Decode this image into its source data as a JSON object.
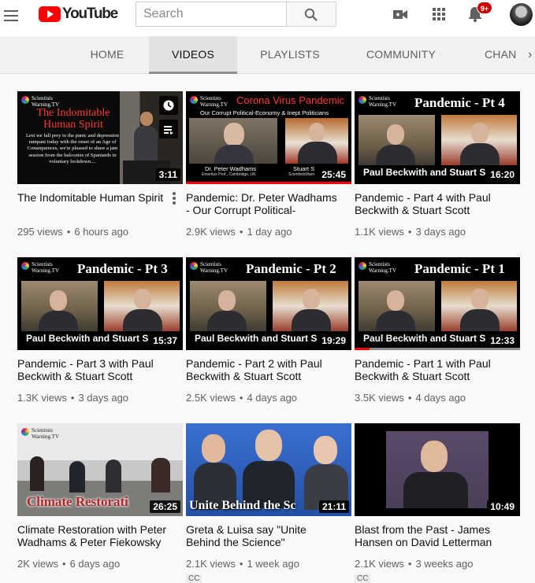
{
  "header": {
    "logo_text": "YouTube",
    "search_placeholder": "Search",
    "notification_count": "9+"
  },
  "tabs": [
    {
      "label": "HOME",
      "active": false
    },
    {
      "label": "VIDEOS",
      "active": true
    },
    {
      "label": "PLAYLISTS",
      "active": false
    },
    {
      "label": "COMMUNITY",
      "active": false
    },
    {
      "label": "CHAN",
      "active": false
    }
  ],
  "videos": [
    {
      "title": "The Indomitable Human Spirit",
      "views": "295 views",
      "age": "6 hours ago",
      "duration": "3:11",
      "thumb_title": "The Indomitable Human Spirit",
      "thumb_text": "Lest we fall prey to the panic and depression rampant today with the onset of an Age of Consequences, we're pleased to share a jam session from the balconies of Spaniards in voluntary lockdown...."
    },
    {
      "title": "Pandemic: Dr. Peter Wadhams - Our Corrupt Political-Economy & Inept Politicians",
      "views": "2.9K views",
      "age": "1 day ago",
      "duration": "25:45",
      "thumb_title": "Corona Virus Pandemic",
      "thumb_subtitle": "Our Corrupt Political-Economy & Inept Politicians",
      "thumb_left_name": "Dr. Peter Wadhams",
      "thumb_left_role": "Emeritus Prof., Cambridge, UK",
      "thumb_right_name": "Stuart S",
      "thumb_right_role": "ScientistsWarn",
      "progress": 1.0
    },
    {
      "title": "Pandemic - Part 4 with Paul Beckwith & Stuart Scott",
      "views": "1.1K views",
      "age": "3 days ago",
      "duration": "16:20",
      "thumb_title": "Pandemic - Pt 4",
      "thumb_caption": "Paul Beckwith and Stuart S"
    },
    {
      "title": "Pandemic - Part 3 with Paul Beckwith & Stuart Scott",
      "views": "1.3K views",
      "age": "3 days ago",
      "duration": "15:37",
      "thumb_title": "Pandemic - Pt 3",
      "thumb_caption": "Paul Beckwith and Stuart S"
    },
    {
      "title": "Pandemic - Part 2 with Paul Beckwith & Stuart Scott",
      "views": "2.5K views",
      "age": "4 days ago",
      "duration": "19:29",
      "thumb_title": "Pandemic - Pt 2",
      "thumb_caption": "Paul Beckwith and Stuart S"
    },
    {
      "title": "Pandemic - Part 1 with Paul Beckwith & Stuart Scott",
      "views": "3.5K views",
      "age": "4 days ago",
      "duration": "12:33",
      "thumb_title": "Pandemic - Pt 1",
      "thumb_caption": "Paul Beckwith and Stuart S",
      "progress": 0.09
    },
    {
      "title": "Climate Restoration with Peter Wadhams & Peter Fiekowsky",
      "views": "2K views",
      "age": "6 days ago",
      "duration": "26:25",
      "thumb_title": "Climate Restorati"
    },
    {
      "title": "Greta & Luisa say \"Unite Behind the Science\"",
      "views": "2.1K views",
      "age": "1 week ago",
      "duration": "21:11",
      "thumb_title": "Unite Behind the Sc",
      "badge": "CC"
    },
    {
      "title": "Blast from the Past - James Hansen on David Letterman Show",
      "views": "2.1K views",
      "age": "3 weeks ago",
      "duration": "10:49",
      "badge": "CC"
    }
  ],
  "channel_logo_text": "Scientists Warning.TV",
  "meta_separator": "•",
  "colors": {
    "youtube_red": "#ff0000",
    "badge_red": "#cc0000",
    "thumb_red_title": "#ff3b30"
  }
}
